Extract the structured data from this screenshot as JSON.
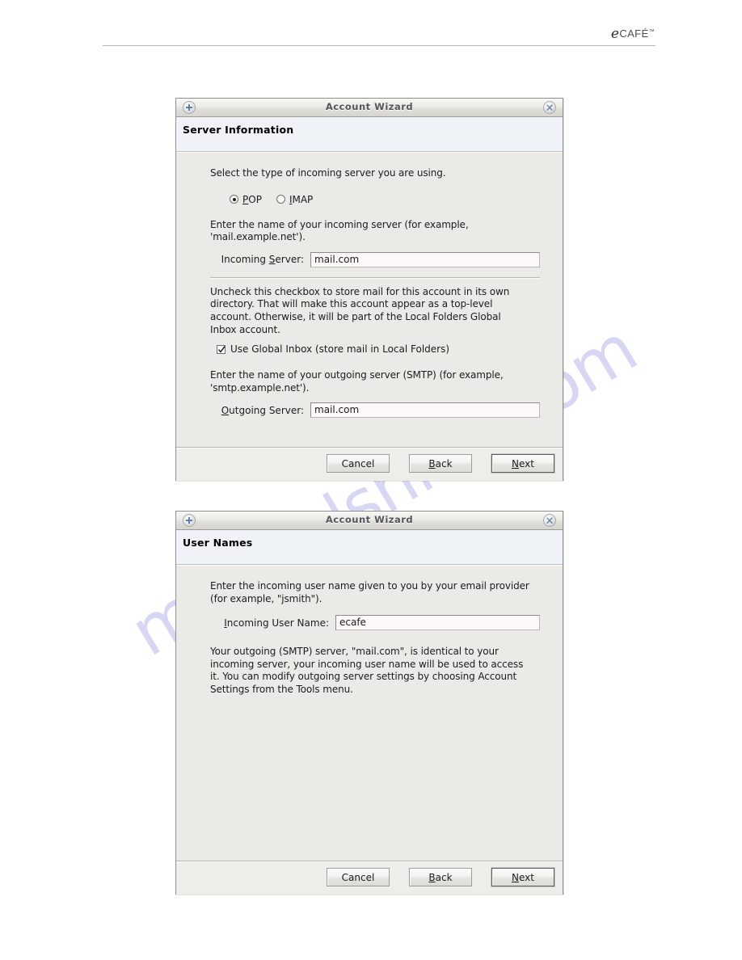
{
  "page": {
    "brand": {
      "prefix": "e",
      "name": "CAFÉ",
      "tm": "™"
    },
    "watermark": "manualshive.com"
  },
  "dialogs": [
    {
      "id": "server-information",
      "titlebar": {
        "title": "Account Wizard",
        "left_icon": "plus-circle-icon",
        "close_icon": "close-circle-icon"
      },
      "section_title": "Server Information",
      "intro": "Select the type of incoming server you are using.",
      "server_type": {
        "selected": "POP",
        "options": [
          {
            "label": "POP",
            "accel": "P",
            "checked": true
          },
          {
            "label": "IMAP",
            "accel": "I",
            "checked": false
          }
        ]
      },
      "incoming_help_line1": "Enter the name of your incoming server (for example,",
      "incoming_help_line2": "'mail.example.net').",
      "incoming_label_pre": "Incoming ",
      "incoming_label_accel": "S",
      "incoming_label_post": "erver:",
      "incoming_value": "mail.com",
      "global_inbox_help": "Uncheck this checkbox to store mail for this account in its own directory. That will make this account appear as a top-level account. Otherwise, it will be part of the Local Folders Global Inbox account.",
      "global_inbox_checkbox": {
        "label": "Use Global Inbox (store mail in Local Folders)",
        "checked": true
      },
      "outgoing_help_line1": "Enter the name of your outgoing server (SMTP) (for example,",
      "outgoing_help_line2": "'smtp.example.net').",
      "outgoing_label_accel": "O",
      "outgoing_label_post": "utgoing Server:",
      "outgoing_value": "mail.com",
      "buttons": {
        "cancel": "Cancel",
        "back_pre": "",
        "back_accel": "B",
        "back_post": "ack",
        "next_accel": "N",
        "next_post": "ext"
      }
    },
    {
      "id": "user-names",
      "titlebar": {
        "title": "Account Wizard",
        "left_icon": "plus-circle-icon",
        "close_icon": "close-circle-icon"
      },
      "section_title": "User Names",
      "intro_line1": "Enter the incoming user name given to you by your email provider",
      "intro_line2": "(for example, \"jsmith\").",
      "user_label_accel": "I",
      "user_label_post": "ncoming User Name:",
      "user_value": "ecafe",
      "note": "Your outgoing (SMTP) server, \"mail.com\", is identical to your incoming server, your incoming user name will be used to access it. You can modify outgoing server settings by choosing Account Settings from the Tools menu.",
      "buttons": {
        "cancel": "Cancel",
        "back_accel": "B",
        "back_post": "ack",
        "next_accel": "N",
        "next_post": "ext"
      }
    }
  ]
}
